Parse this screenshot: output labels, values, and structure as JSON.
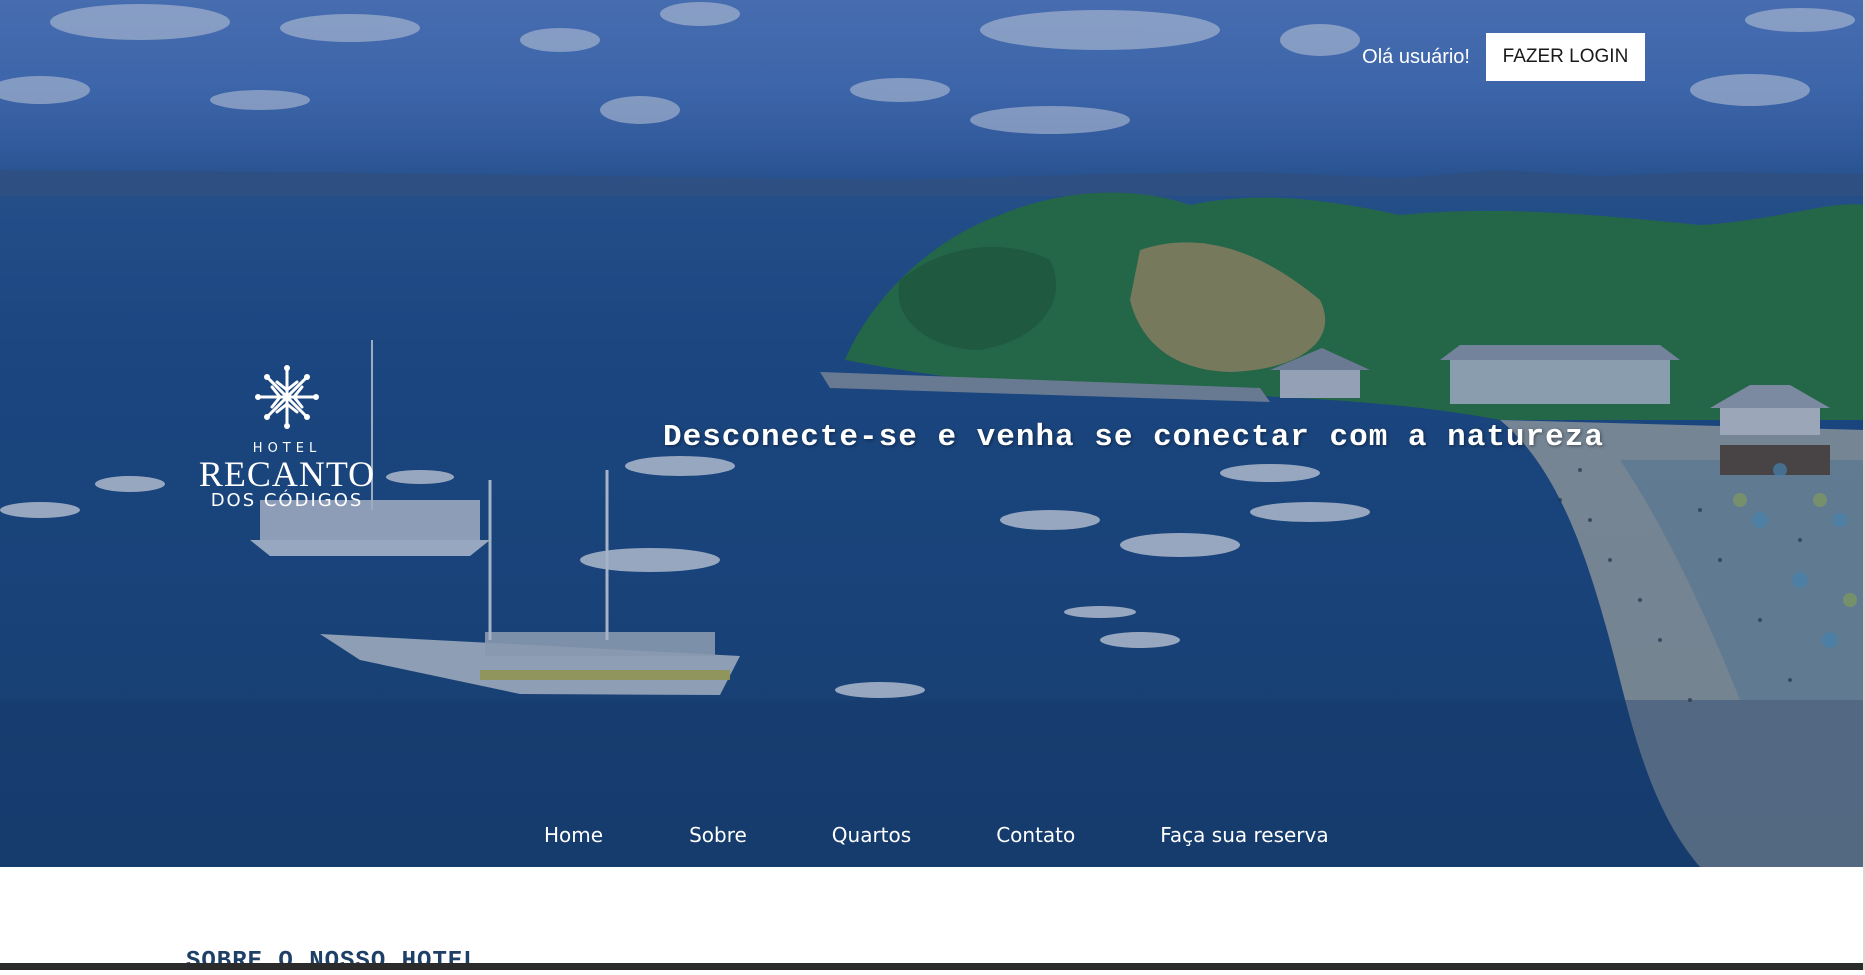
{
  "header": {
    "greeting": "Olá usuário!",
    "login_label": "FAZER LOGIN"
  },
  "logo": {
    "line1": "HOTEL",
    "line2": "RECANTO",
    "line3": "DOS CÓDIGOS"
  },
  "hero": {
    "tagline": "Desconecte-se e venha se conectar com a natureza"
  },
  "nav": {
    "items": [
      {
        "label": "Home"
      },
      {
        "label": "Sobre"
      },
      {
        "label": "Quartos"
      },
      {
        "label": "Contato"
      },
      {
        "label": "Faça sua reserva"
      }
    ]
  },
  "about": {
    "title": "SOBRE O NOSSO HOTEL"
  },
  "colors": {
    "hero_blue": "#1f4e86",
    "title_text": "#1e3f66",
    "nav_text": "#ffffff",
    "login_bg": "#ffffff"
  }
}
